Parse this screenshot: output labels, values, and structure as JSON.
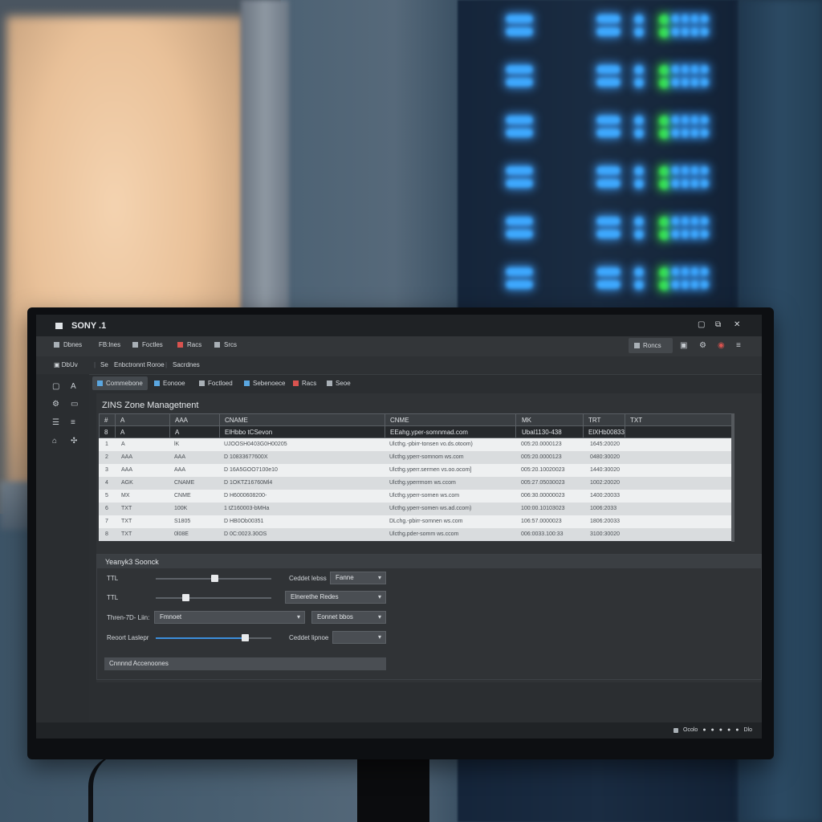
{
  "app": {
    "title": "SONY .1"
  },
  "window_controls": [
    "▢",
    "⧉",
    "✕"
  ],
  "menubar": {
    "items": [
      "Dbnes",
      "FB:lnes",
      "Foctles",
      "Racs",
      "Srcs"
    ],
    "right_button": "Roncs"
  },
  "toolbar2": {
    "items": [
      "DbUv",
      "Se",
      "Enbctronnt Roroe",
      "Sacrdnes"
    ]
  },
  "sidebar": {
    "icons": [
      "square-icon",
      "letter-a-icon",
      "gear-icon",
      "monitor-icon",
      "list-icon",
      "menu-icon",
      "home-icon",
      "network-icon"
    ]
  },
  "tabs": [
    "Commebone",
    "Eonooe",
    "Foctloed",
    "Sebenoece",
    "Racs",
    "Seoe"
  ],
  "page": {
    "title": "ZINS Zone Managetnent"
  },
  "table": {
    "headers": [
      "#",
      "A",
      "AAA",
      "CNAME",
      "CNME",
      "MK",
      "TRT",
      "TXT"
    ],
    "subheader": [
      "8",
      "A",
      "A",
      "ElHbbo tCSevon",
      "EEahg.yper-somnmad.com",
      "Ubal1130-438",
      "ElXHb00833"
    ],
    "rows": [
      [
        "1",
        "A",
        "lK",
        "UJOOSH0403G0H00205",
        "Ulcthg.-pbirr-tonsen vo.ds.otoom)",
        "005:20.0000123",
        "1645:20020"
      ],
      [
        "2",
        "AAA",
        "AAA",
        "D 10833677600X",
        "Ulcthg.yperr-somnom ws.com",
        "005:20.0000123",
        "0480:30020"
      ],
      [
        "3",
        "AAA",
        "AAA",
        "D 16A5GOO7100e10",
        "Ulcthg.yperr.sermen vs.oo.ocom]",
        "005:20.10020023",
        "1440:30020"
      ],
      [
        "4",
        "AGK",
        "CNAME",
        "D 1OKTZ16760Ml4",
        "Ulcthg.yperrmorn ws.ccom",
        "005:27.05030023",
        "1002:20020"
      ],
      [
        "5",
        "MX",
        "CNME",
        "D H6000608200-",
        "Ulcthg.yperr-sornen ws.com",
        "006:30.00000023",
        "1400:20033"
      ],
      [
        "6",
        "TXT",
        "100K",
        "1 tZ160003-bMHa",
        "Ulcthg.yperr-somen ws.ad.ccom)",
        "100:00.10103023",
        "1006:2033"
      ],
      [
        "7",
        "TXT",
        "S1805",
        "D HB0Ob00351",
        "DLchg.-pbirr-somnen ws.com",
        "106:57.0000023",
        "1806:20033"
      ],
      [
        "8",
        "TXT",
        "0l08E",
        "D 0C:0023.30OS",
        "Ulcthg.pder-somm ws.ccom",
        "006:0033.100:33",
        "3100:30020"
      ]
    ]
  },
  "search_panel": {
    "title": "Yeanyk3 Soonck",
    "ttl1_label": "TTL",
    "ttl1_value": 0.51,
    "ttl2_label": "TTL",
    "ttl2_value": 0.26,
    "thenfilter_label": "Thren-7D- Liin:",
    "thenfilter_value": "Fmnoet",
    "record_label": "Reoort Laslepr",
    "record_value": 0.77,
    "right": {
      "cd_label": "Ceddet lebss",
      "cd_value": "Fanne",
      "em_value": "Elnerethe Redes",
      "ec_value": "Eonnet bbos",
      "ct_label": "Ceddet lipnoe",
      "ct_value": ""
    },
    "bottom_bar": "Cnnnnd Accenoones"
  },
  "statusbar": {
    "items": [
      "Ocolo",
      "●",
      "●",
      "●",
      "●",
      "●",
      "Dlo"
    ]
  }
}
